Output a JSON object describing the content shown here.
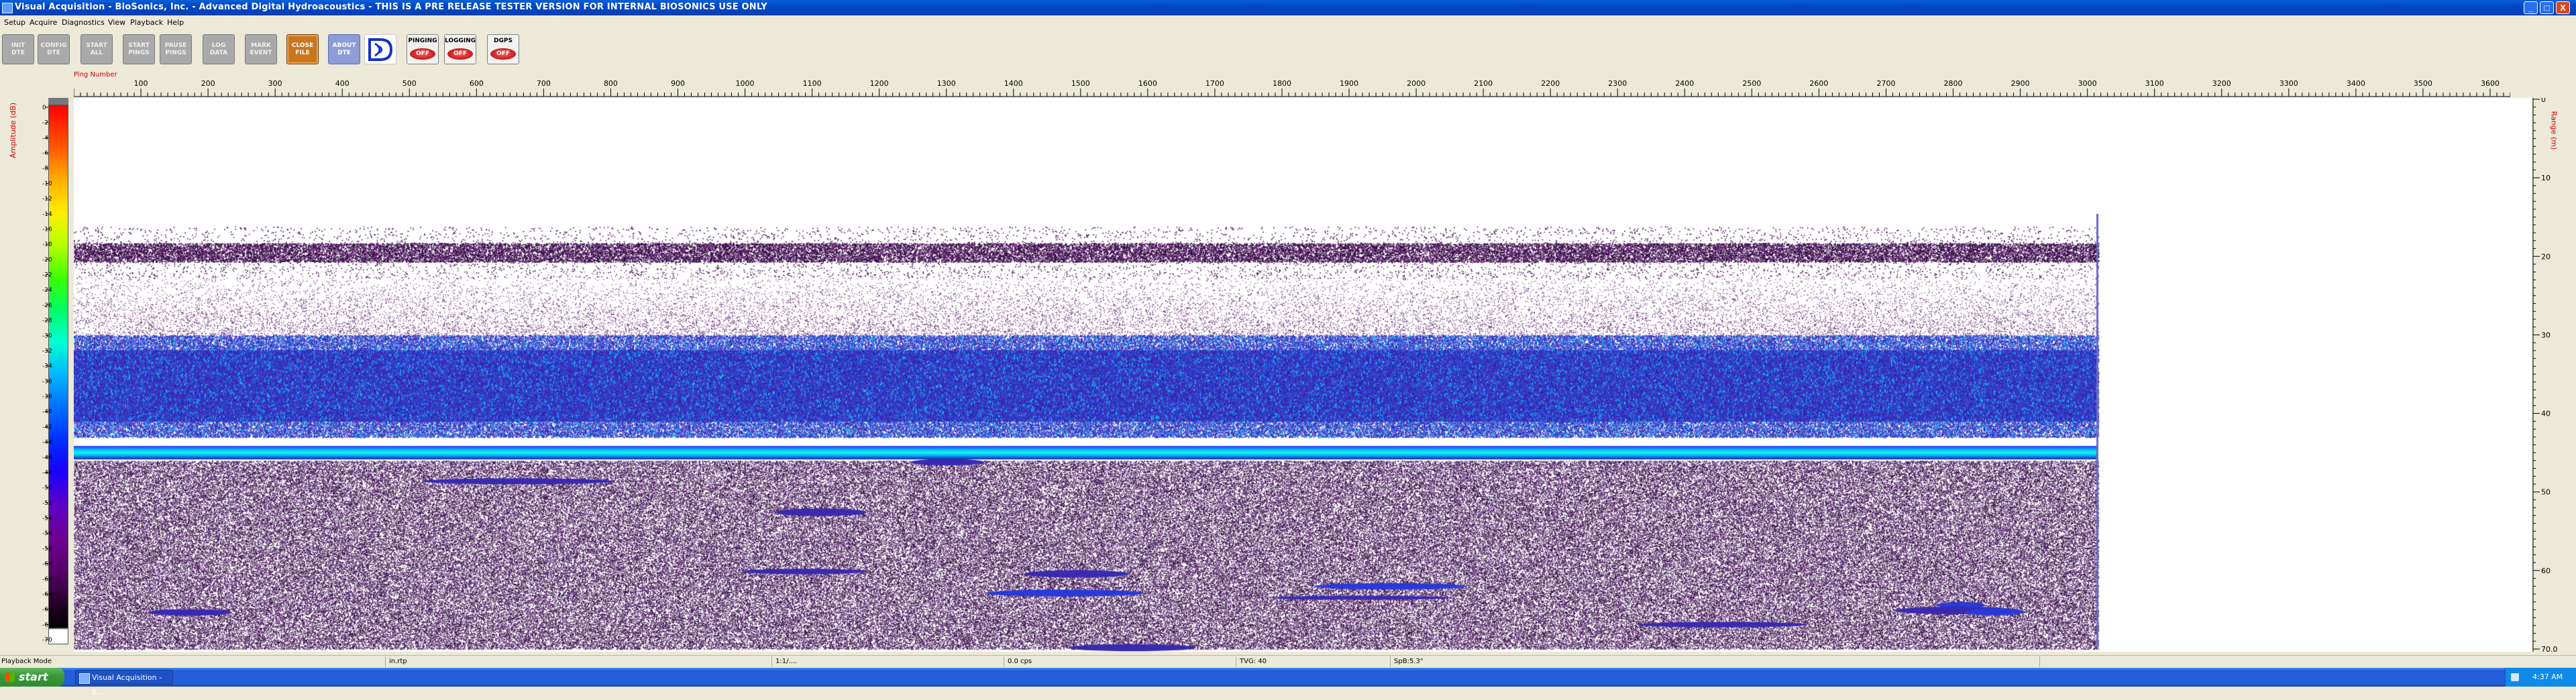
{
  "window": {
    "title": "Visual Acquisition  -  BioSonics, Inc.  -  Advanced Digital Hydroacoustics  -  THIS IS A PRE RELEASE TESTER VERSION FOR INTERNAL BIOSONICS USE ONLY",
    "min_glyph": "_",
    "max_glyph": "□",
    "close_glyph": "X"
  },
  "menu": [
    "Setup",
    "Acquire",
    "Diagnostics",
    "View",
    "Playback",
    "Help"
  ],
  "toolbar": {
    "buttons": [
      {
        "name": "init-dte",
        "line1": "INIT",
        "line2": "DTE",
        "style": "gray"
      },
      {
        "name": "config-dte",
        "line1": "CONFIG",
        "line2": "DTE",
        "style": "gray"
      },
      {
        "name": "start-all",
        "line1": "START",
        "line2": "ALL",
        "style": "gray"
      },
      {
        "name": "start-pings",
        "line1": "START",
        "line2": "PINGS",
        "style": "gray"
      },
      {
        "name": "pause-pings",
        "line1": "PAUSE",
        "line2": "PINGS",
        "style": "gray"
      },
      {
        "name": "log-data",
        "line1": "LOG",
        "line2": "DATA",
        "style": "gray"
      },
      {
        "name": "mark-event",
        "line1": "MARK",
        "line2": "EVENT",
        "style": "gray"
      },
      {
        "name": "close-file",
        "line1": "CLOSE",
        "line2": "FILE",
        "style": "orange"
      },
      {
        "name": "about-dte",
        "line1": "ABOUT",
        "line2": "DTE",
        "style": "blue"
      }
    ],
    "toggles": [
      {
        "name": "pinging",
        "label": "PINGING",
        "state": "OFF"
      },
      {
        "name": "logging",
        "label": "LOGGING",
        "state": "OFF"
      },
      {
        "name": "dgps",
        "label": "DGPS",
        "state": "OFF"
      }
    ]
  },
  "chart_data": {
    "type": "heatmap",
    "title": "",
    "xlabel": "Ping Number",
    "ylabel": "Amplitude (dB)",
    "y2label": "Range (m)",
    "x_ticks": [
      100,
      200,
      300,
      400,
      500,
      600,
      700,
      800,
      900,
      1000,
      1100,
      1200,
      1300,
      1400,
      1500,
      1600,
      1700,
      1800,
      1900,
      2000,
      2100,
      2200,
      2300,
      2400,
      2500,
      2600,
      2700,
      2800,
      2900,
      3000,
      3100,
      3200,
      3300,
      3400,
      3500,
      3600
    ],
    "xlim": [
      0,
      3630
    ],
    "data_extent_pings": [
      0,
      2990
    ],
    "color_scale_db": [
      0,
      -2,
      -4,
      -6,
      -8,
      -10,
      -12,
      -14,
      -16,
      -18,
      -20,
      -22,
      -24,
      -26,
      -28,
      -30,
      -32,
      -34,
      -36,
      -38,
      -40,
      -42,
      -44,
      -46,
      -48,
      -50,
      -52,
      -54,
      -56,
      -58,
      -60,
      -62,
      -64,
      -66,
      -68,
      -70
    ],
    "range_ticks_m": [
      0,
      10,
      20,
      30,
      40,
      50,
      60,
      70.0
    ],
    "range_tick_labels": [
      "0",
      "10",
      "20",
      "30",
      "40",
      "50",
      "60",
      "70.0"
    ],
    "ylim_range_m": [
      0,
      70
    ],
    "features": {
      "surface_noise_band_m": [
        18,
        21
      ],
      "scattering_layer_m": [
        30,
        43
      ],
      "bottom_echo_m": 45,
      "sub_bottom_m": [
        46,
        70
      ]
    }
  },
  "status": {
    "mode": "Playback Mode",
    "file": "in.rtp",
    "field3": "1:1/....",
    "field4": "0.0 cps",
    "tvg": "TVG: 40",
    "spb": "SpB:5.3\""
  },
  "taskbar": {
    "start_label": "start",
    "task_label": "Visual Acquisition - B...",
    "clock": "4:37 AM"
  }
}
